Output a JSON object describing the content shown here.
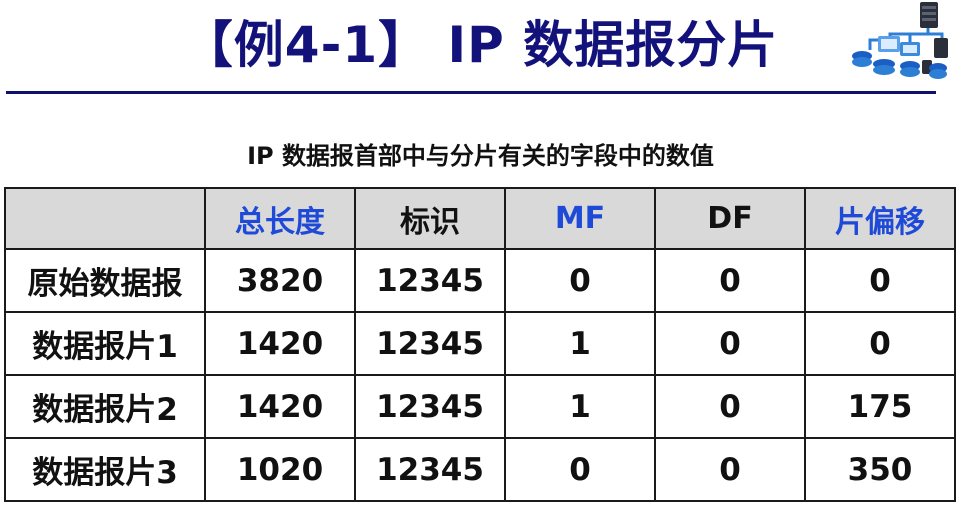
{
  "slide": {
    "title": "【例4-1】 IP 数据报分片",
    "caption": "IP 数据报首部中与分片有关的字段中的数值"
  },
  "colors": {
    "title": "#12127a",
    "header_blue": "#1f4ad8",
    "row_label_red": "#c00000",
    "header_bg": "#d9d9d9"
  },
  "logo": {
    "icon": "network-topology-icon"
  },
  "table": {
    "headers": [
      "",
      "总长度",
      "标识",
      "MF",
      "DF",
      "片偏移"
    ],
    "rows": [
      {
        "label": "原始数据报",
        "total_length": "3820",
        "identification": "12345",
        "mf": "0",
        "df": "0",
        "offset": "0"
      },
      {
        "label": "数据报片1",
        "total_length": "1420",
        "identification": "12345",
        "mf": "1",
        "df": "0",
        "offset": "0"
      },
      {
        "label": "数据报片2",
        "total_length": "1420",
        "identification": "12345",
        "mf": "1",
        "df": "0",
        "offset": "175"
      },
      {
        "label": "数据报片3",
        "total_length": "1020",
        "identification": "12345",
        "mf": "0",
        "df": "0",
        "offset": "350"
      }
    ]
  }
}
